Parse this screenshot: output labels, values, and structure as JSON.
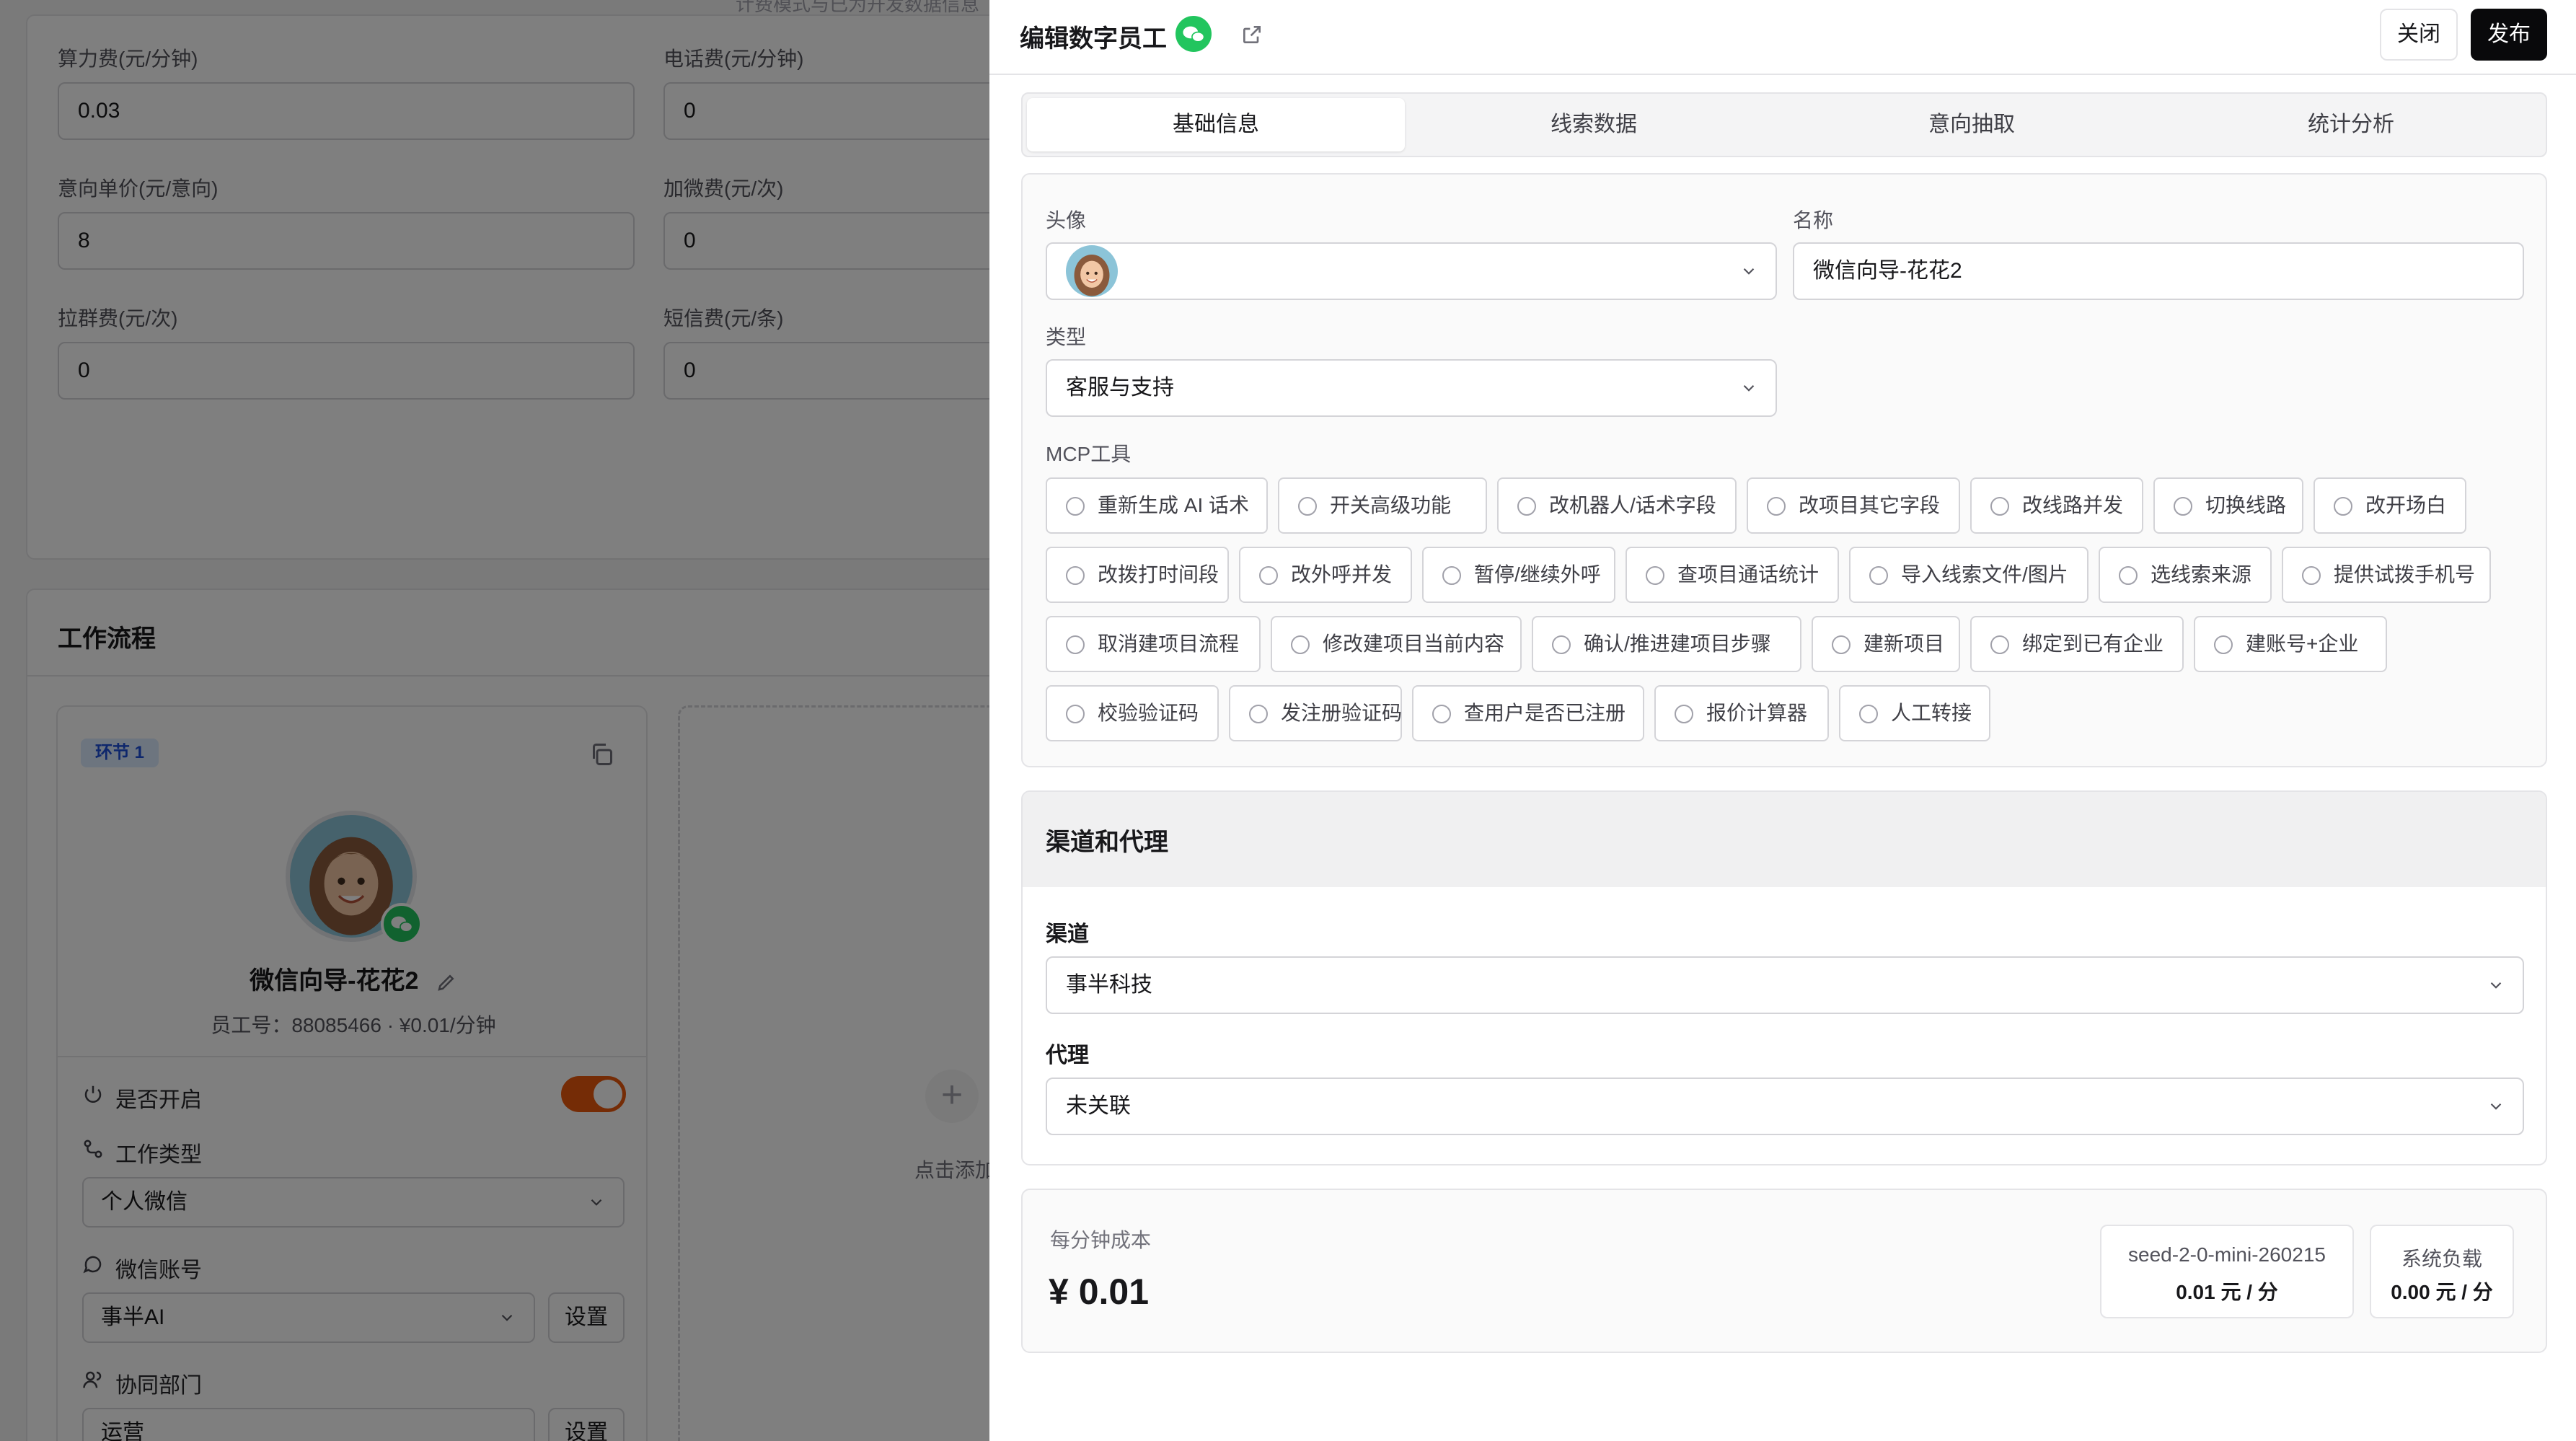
{
  "background": {
    "top_hint": "计费模式与已为开发数据信息",
    "fields": [
      {
        "label": "算力费(元/分钟)",
        "value": "0.03"
      },
      {
        "label": "电话费(元/分钟)",
        "value": "0"
      },
      {
        "label": "意向单价(元/意向)",
        "value": "8"
      },
      {
        "label": "加微费(元/次)",
        "value": "0"
      },
      {
        "label": "拉群费(元/次)",
        "value": "0"
      },
      {
        "label": "短信费(元/条)",
        "value": "0"
      }
    ],
    "workflow_title": "工作流程",
    "step": {
      "badge": "环节 1",
      "name": "微信向导-花花2",
      "meta": "员工号：88085466 · ¥0.01/分钟",
      "enabled_label": "是否开启",
      "enabled": true,
      "work_type_label": "工作类型",
      "work_type_value": "个人微信",
      "wechat_account_label": "微信账号",
      "wechat_account_value": "事半AI",
      "settings_label": "设置",
      "dept_label": "协同部门",
      "dept_value": "运营",
      "dept_settings_label": "设置"
    },
    "add_text": "点击添加"
  },
  "drawer": {
    "title": "编辑数字员工",
    "close_label": "关闭",
    "publish_label": "发布",
    "tabs": [
      "基础信息",
      "线索数据",
      "意向抽取",
      "统计分析"
    ],
    "active_tab": 0,
    "avatar_label": "头像",
    "name_label": "名称",
    "name_value": "微信向导-花花2",
    "type_label": "类型",
    "type_value": "客服与支持",
    "mcp_label": "MCP工具",
    "mcp_tools": [
      "重新生成 AI 话术",
      "开关高级功能",
      "改机器人/话术字段",
      "改项目其它字段",
      "改线路并发",
      "切换线路",
      "改开场白",
      "改拨打时间段",
      "改外呼并发",
      "暂停/继续外呼",
      "查项目通话统计",
      "导入线索文件/图片",
      "选线索来源",
      "提供试拨手机号",
      "取消建项目流程",
      "修改建项目当前内容",
      "确认/推进建项目步骤",
      "建新项目",
      "绑定到已有企业",
      "建账号+企业",
      "校验验证码",
      "发注册验证码",
      "查用户是否已注册",
      "报价计算器",
      "人工转接"
    ],
    "channel_section_title": "渠道和代理",
    "channel_label": "渠道",
    "channel_value": "事半科技",
    "agent_label": "代理",
    "agent_value": "未关联",
    "cost_label": "每分钟成本",
    "cost_value": "¥ 0.01",
    "model_name": "seed-2-0-mini-260215",
    "model_price": "0.01 元 / 分",
    "system_load_label": "系统负载",
    "system_load_value": "0.00 元 / 分"
  },
  "colors": {
    "accent_orange": "#ea580c",
    "wechat_green": "#22c55e",
    "publish_black": "#09090b",
    "badge_blue": "#1d4ed8"
  }
}
